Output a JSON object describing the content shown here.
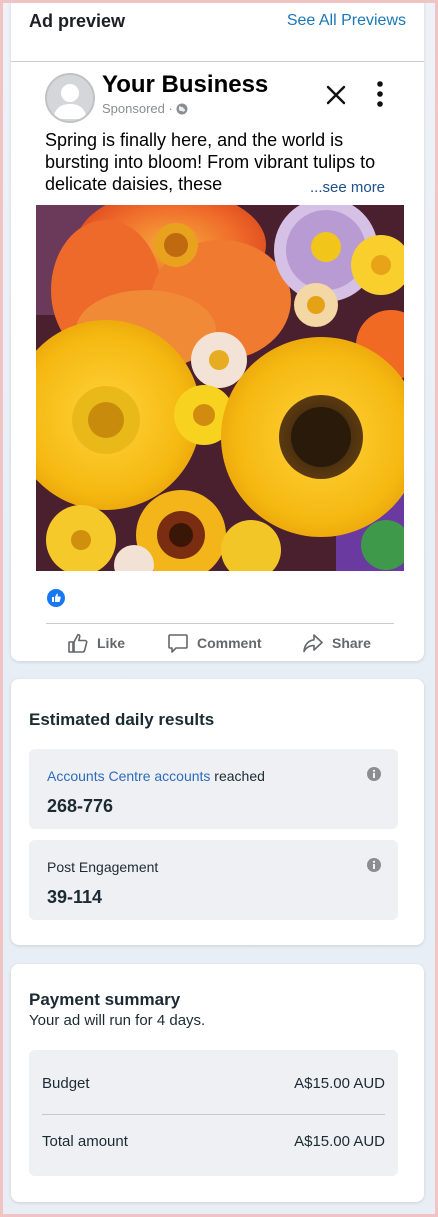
{
  "preview": {
    "title": "Ad preview",
    "see_all": "See All Previews"
  },
  "ad": {
    "business_name": "Your Business",
    "sponsored": "Sponsored ·",
    "text": "Spring is finally here, and the world is bursting into bloom! From vibrant tulips to delicate daisies, these",
    "see_more": "...see more",
    "actions": {
      "like": "Like",
      "comment": "Comment",
      "share": "Share"
    }
  },
  "results": {
    "title": "Estimated daily results",
    "reach": {
      "label_link": "Accounts Centre accounts",
      "label_rest": " reached",
      "value": "268-776"
    },
    "engagement": {
      "label": "Post Engagement",
      "value": "39-114"
    }
  },
  "payment": {
    "title": "Payment summary",
    "subtitle": "Your ad will run for 4 days.",
    "rows": [
      {
        "label": "Budget",
        "value": "A$15.00 AUD"
      },
      {
        "label": "Total amount",
        "value": "A$15.00 AUD"
      }
    ]
  },
  "colors": {
    "link": "#1a77b8",
    "like_blue": "#1877f2"
  },
  "icons": [
    "globe-icon",
    "close-icon",
    "more-options-icon",
    "like-badge-icon",
    "thumbs-up-icon",
    "comment-icon",
    "share-icon",
    "info-icon"
  ]
}
